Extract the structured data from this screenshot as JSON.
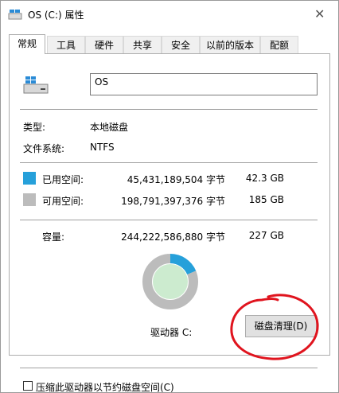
{
  "window": {
    "title": "OS (C:) 属性",
    "close_icon": "close-icon"
  },
  "tabs": [
    "常规",
    "工具",
    "硬件",
    "共享",
    "安全",
    "以前的版本",
    "配额"
  ],
  "general": {
    "name_value": "OS",
    "type_label": "类型:",
    "type_value": "本地磁盘",
    "fs_label": "文件系统:",
    "fs_value": "NTFS",
    "used_label": "已用空间:",
    "used_bytes": "45,431,189,504 字节",
    "used_gb": "42.3 GB",
    "free_label": "可用空间:",
    "free_bytes": "198,791,397,376 字节",
    "free_gb": "185 GB",
    "capacity_label": "容量:",
    "capacity_bytes": "244,222,586,880 字节",
    "capacity_gb": "227 GB",
    "drive_label": "驱动器 C:",
    "cleanup_button": "磁盘清理(D)",
    "compress_checkbox": "压缩此驱动器以节约磁盘空间(C)"
  },
  "colors": {
    "used": "#26a0da",
    "free": "#bcbcbc",
    "annotation": "#e0141e"
  },
  "chart_data": {
    "type": "pie",
    "categories": [
      "已用空间",
      "可用空间"
    ],
    "values": [
      45431189504,
      198791397376
    ]
  }
}
